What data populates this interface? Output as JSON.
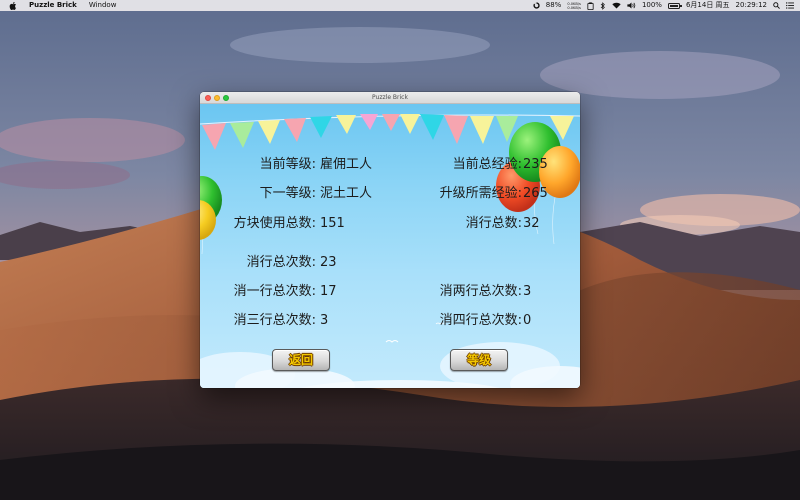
{
  "menubar": {
    "app_name": "Puzzle Brick",
    "menus": [
      "Window"
    ],
    "cpu_percent": "88%",
    "net_up": "0.0KB/s",
    "net_down": "0.0KB/s",
    "battery_percent": "100%",
    "battery_level": 1.0,
    "date": "6月14日 周五",
    "time": "20:29:12",
    "icons": [
      "apple-icon",
      "cpu-ring-icon",
      "network-arrows-icon",
      "clipboard-icon",
      "bluetooth-icon",
      "wifi-icon",
      "volume-icon",
      "battery-icon",
      "spotlight-icon",
      "notification-center-icon"
    ]
  },
  "window": {
    "title": "Puzzle Brick"
  },
  "stats": {
    "current_level_label": "当前等级:",
    "current_level_value": "雇佣工人",
    "next_level_label": "下一等级:",
    "next_level_value": "泥土工人",
    "total_blocks_label": "方块使用总数:",
    "total_blocks_value": "151",
    "current_exp_label": "当前总经验:",
    "current_exp_value": "235",
    "upgrade_exp_label": "升级所需经验:",
    "upgrade_exp_value": "265",
    "total_lines_label": "消行总数:",
    "total_lines_value": "32",
    "clear_times_label": "消行总次数:",
    "clear_times_value": "23",
    "single_label": "消一行总次数:",
    "single_value": "17",
    "double_label": "消两行总次数:",
    "double_value": "3",
    "triple_label": "消三行总次数:",
    "triple_value": "3",
    "quad_label": "消四行总次数:",
    "quad_value": "0"
  },
  "buttons": {
    "back": "返回",
    "level": "等级"
  },
  "colors": {
    "sky_top": "#6bc6f1",
    "sky_bottom": "#c3eafc",
    "button_text": "#f3c700",
    "button_outline": "#6b3a00"
  }
}
